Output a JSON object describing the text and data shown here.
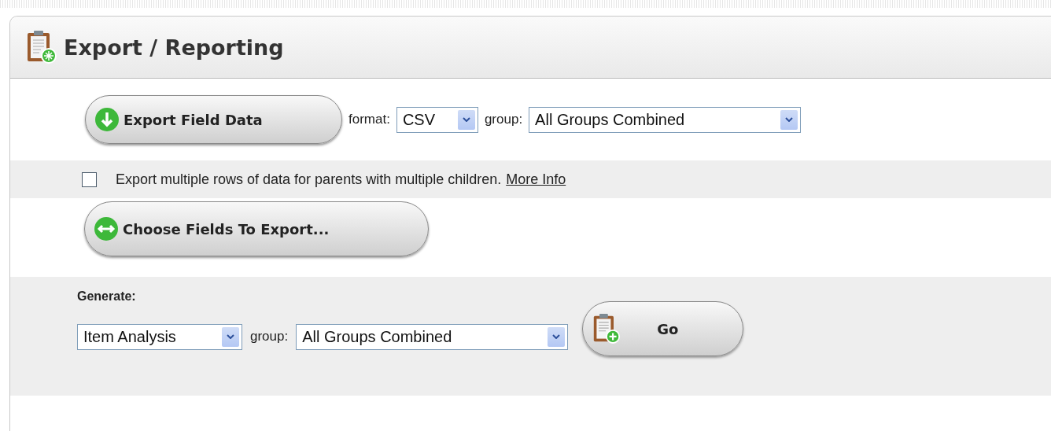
{
  "panel": {
    "title": "Export / Reporting"
  },
  "export": {
    "button": "Export Field Data",
    "format_label": "format:",
    "format_value": "CSV",
    "group_label": "group:",
    "group_value": "All Groups Combined"
  },
  "multiple_rows": {
    "checked": false,
    "text": "Export multiple rows of data for parents with multiple children.",
    "link": "More Info"
  },
  "choose_button": "Choose Fields To Export...",
  "generate": {
    "label": "Generate:",
    "report_value": "Item Analysis",
    "group_label": "group:",
    "group_value": "All Groups Combined",
    "button": "Go"
  }
}
